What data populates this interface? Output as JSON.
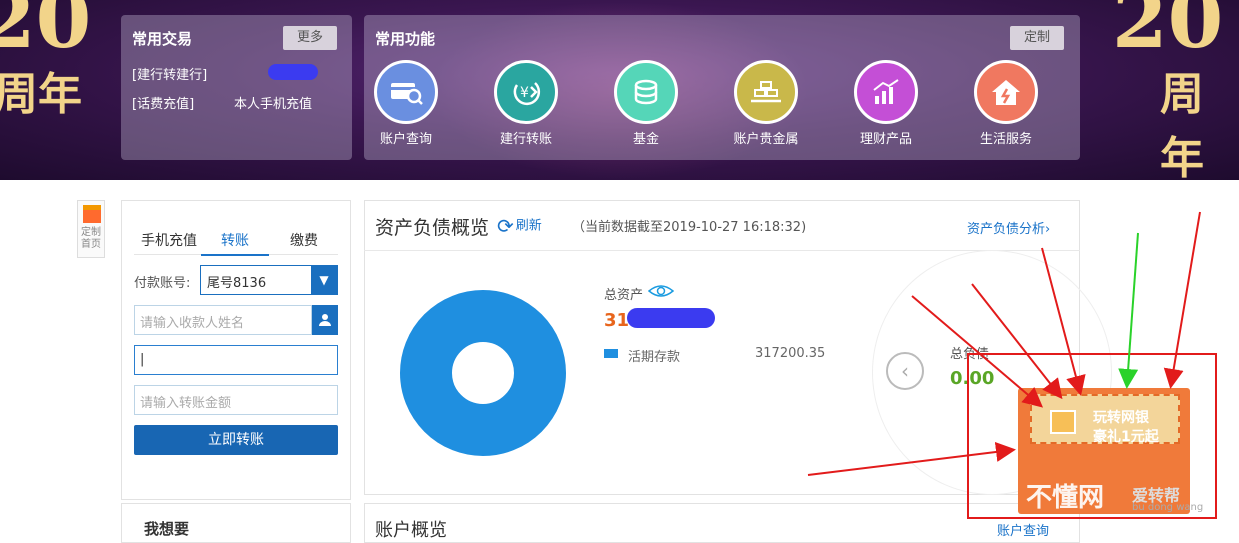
{
  "banner": {
    "anniversary_left": "周年",
    "anniversary_right": "周年",
    "anniversary_num": "20"
  },
  "common_trade": {
    "title": "常用交易",
    "more": "更多",
    "items": [
      "[建行转建行]",
      "[话费充值]"
    ],
    "item2_value": "本人手机充值"
  },
  "common_functions": {
    "title": "常用功能",
    "customize": "定制",
    "items": [
      {
        "label": "账户查询",
        "color": "#6a8fe0",
        "icon": "card-search-icon"
      },
      {
        "label": "建行转账",
        "color": "#2aa6a0",
        "icon": "yen-transfer-icon"
      },
      {
        "label": "基金",
        "color": "#55d6b8",
        "icon": "coins-icon"
      },
      {
        "label": "账户贵金属",
        "color": "#c9b84a",
        "icon": "gold-bars-icon"
      },
      {
        "label": "理财产品",
        "color": "#c44fd6",
        "icon": "growth-chart-icon"
      },
      {
        "label": "生活服务",
        "color": "#f07860",
        "icon": "house-icon"
      }
    ]
  },
  "side_tab": {
    "label": "定制首页"
  },
  "transfer": {
    "tabs": [
      "手机充值",
      "转账",
      "缴费"
    ],
    "pay_account_label": "付款账号:",
    "pay_account_value": "尾号8136",
    "payee_name_placeholder": "请输入收款人姓名",
    "account_input_value": "|",
    "amount_placeholder": "请输入转账金额",
    "submit": "立即转账"
  },
  "want_section": {
    "title": "我想要"
  },
  "assets": {
    "title": "资产负债概览",
    "refresh": "刷新",
    "data_time": "（当前数据截至2019-10-27 16:18:32)",
    "analysis_link": "资产负债分析",
    "total_label": "总资产",
    "total_value_partial": "31",
    "legend_label": "活期存款",
    "legend_value": "317200.35",
    "debt_label": "总负债",
    "debt_value": "0.00"
  },
  "chart_data": {
    "type": "pie",
    "categories": [
      "活期存款"
    ],
    "values": [
      317200.35
    ],
    "colors": [
      "#1f8fe0"
    ]
  },
  "overview": {
    "title": "账户概览",
    "link": "账户查询"
  },
  "promo": {
    "line1": "玩转网银",
    "line2": "豪礼1元起",
    "close": "×"
  },
  "watermark": {
    "main": "不懂网",
    "side": "爱转帮",
    "pinyin": "bu dong wang"
  }
}
